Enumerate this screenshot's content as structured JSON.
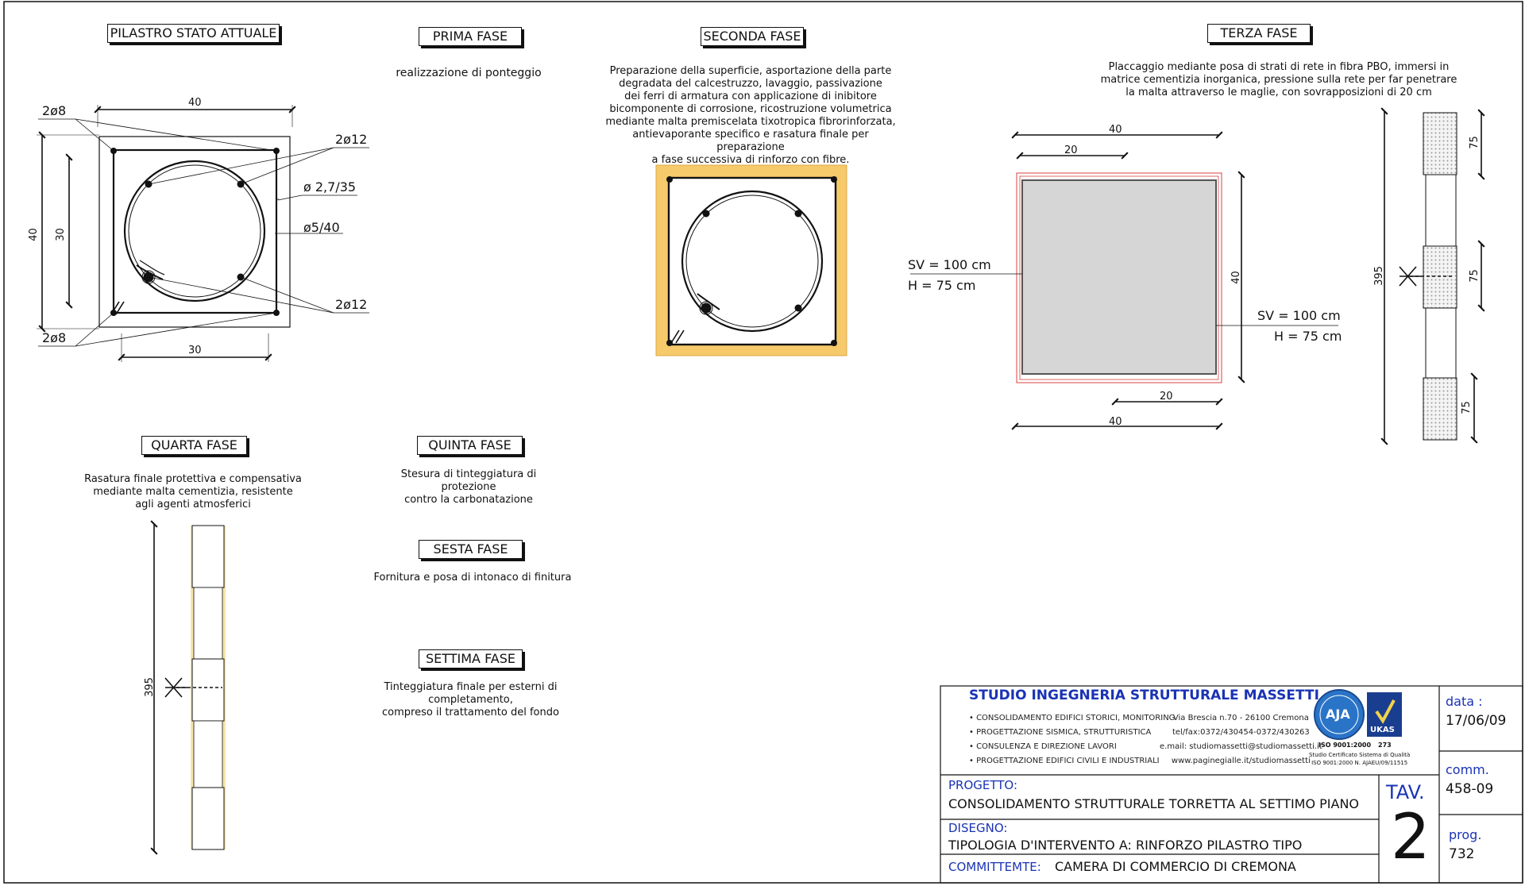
{
  "phases": {
    "pilastro": {
      "title": "PILASTRO STATO ATTUALE"
    },
    "prima": {
      "title": "PRIMA FASE",
      "desc": "realizzazione di ponteggio"
    },
    "seconda": {
      "title": "SECONDA FASE",
      "desc": [
        "Preparazione della superficie, asportazione della parte",
        "degradata del calcestruzzo, lavaggio, passivazione",
        "dei ferri di armatura con applicazione di inibitore",
        "bicomponente di corrosione, ricostruzione volumetrica",
        "mediante malta premiscelata tixotropica fibrorinforzata,",
        "antievaporante specifico e rasatura finale per preparazione",
        "a fase successiva di rinforzo con fibre."
      ]
    },
    "terza": {
      "title": "TERZA FASE",
      "desc": [
        "Placcaggio mediante posa di strati di rete in fibra PBO, immersi in",
        "matrice cementizia inorganica, pressione sulla rete per far penetrare",
        "la malta attraverso le maglie, con sovrapposizioni di 20 cm"
      ]
    },
    "quarta": {
      "title": "QUARTA FASE",
      "desc": [
        "Rasatura finale protettiva e compensativa",
        "mediante malta cementizia, resistente",
        "agli agenti atmosferici"
      ]
    },
    "quinta": {
      "title": "QUINTA FASE",
      "desc": [
        "Stesura di tinteggiatura di protezione",
        "contro la carbonatazione"
      ]
    },
    "sesta": {
      "title": "SESTA FASE",
      "desc": "Fornitura e posa di intonaco di finitura"
    },
    "settima": {
      "title": "SETTIMA FASE",
      "desc": [
        "Tinteggiatura finale per esterni di completamento,",
        "compreso il trattamento del fondo"
      ]
    }
  },
  "dims": {
    "d40": "40",
    "d30": "30",
    "d20": "20",
    "d75": "75",
    "d395": "395",
    "bar_2o8": "2ø8",
    "bar_2o12": "2ø12",
    "stirrup_1": "ø 2,7/35",
    "stirrup_2": "ø5/40",
    "sv": "SV = 100 cm",
    "h": "H = 75 cm"
  },
  "titleblock": {
    "studio": "STUDIO  INGEGNERIA  STRUTTURALE  MASSETTI",
    "services": [
      "• CONSOLIDAMENTO EDIFICI STORICI, MONITORING",
      "• PROGETTAZIONE SISMICA, STRUTTURISTICA",
      "• CONSULENZA E DIREZIONE LAVORI",
      "• PROGETTAZIONE EDIFICI CIVILI E INDUSTRIALI"
    ],
    "contacts": [
      "Via Brescia n.70 - 26100 Cremona",
      "tel/fax:0372/430454-0372/430263",
      "e.mail: studiomassetti@studiomassetti.it",
      "www.paginegialle.it/studiomassetti"
    ],
    "iso": "ISO 9001:2000",
    "cert_num": "273",
    "cert_note": [
      "Studio Certificato Sistema di Qualità",
      "ISO 9001:2000  N. AJAEU/09/11515"
    ],
    "aja": "AJA",
    "ukas": "UKAS",
    "progetto_label": "PROGETTO:",
    "progetto": "CONSOLIDAMENTO STRUTTURALE TORRETTA AL SETTIMO PIANO",
    "disegno_label": "DISEGNO:",
    "disegno": "TIPOLOGIA D'INTERVENTO A: RINFORZO PILASTRO TIPO",
    "committente_label": "COMMITTEMTE:",
    "committente": "CAMERA DI COMMERCIO DI CREMONA",
    "tav_label": "TAV.",
    "tav": "2",
    "data_label": "data :",
    "data": "17/06/09",
    "comm_label": "comm.",
    "comm": "458-09",
    "prog_label": "prog.",
    "prog": "732"
  },
  "colors": {
    "line": "#111111",
    "title_blue": "#1a33b5",
    "mortar": "#f6c96a",
    "pbo_red": "#d84040",
    "plate_gray": "#d6d6d6"
  }
}
